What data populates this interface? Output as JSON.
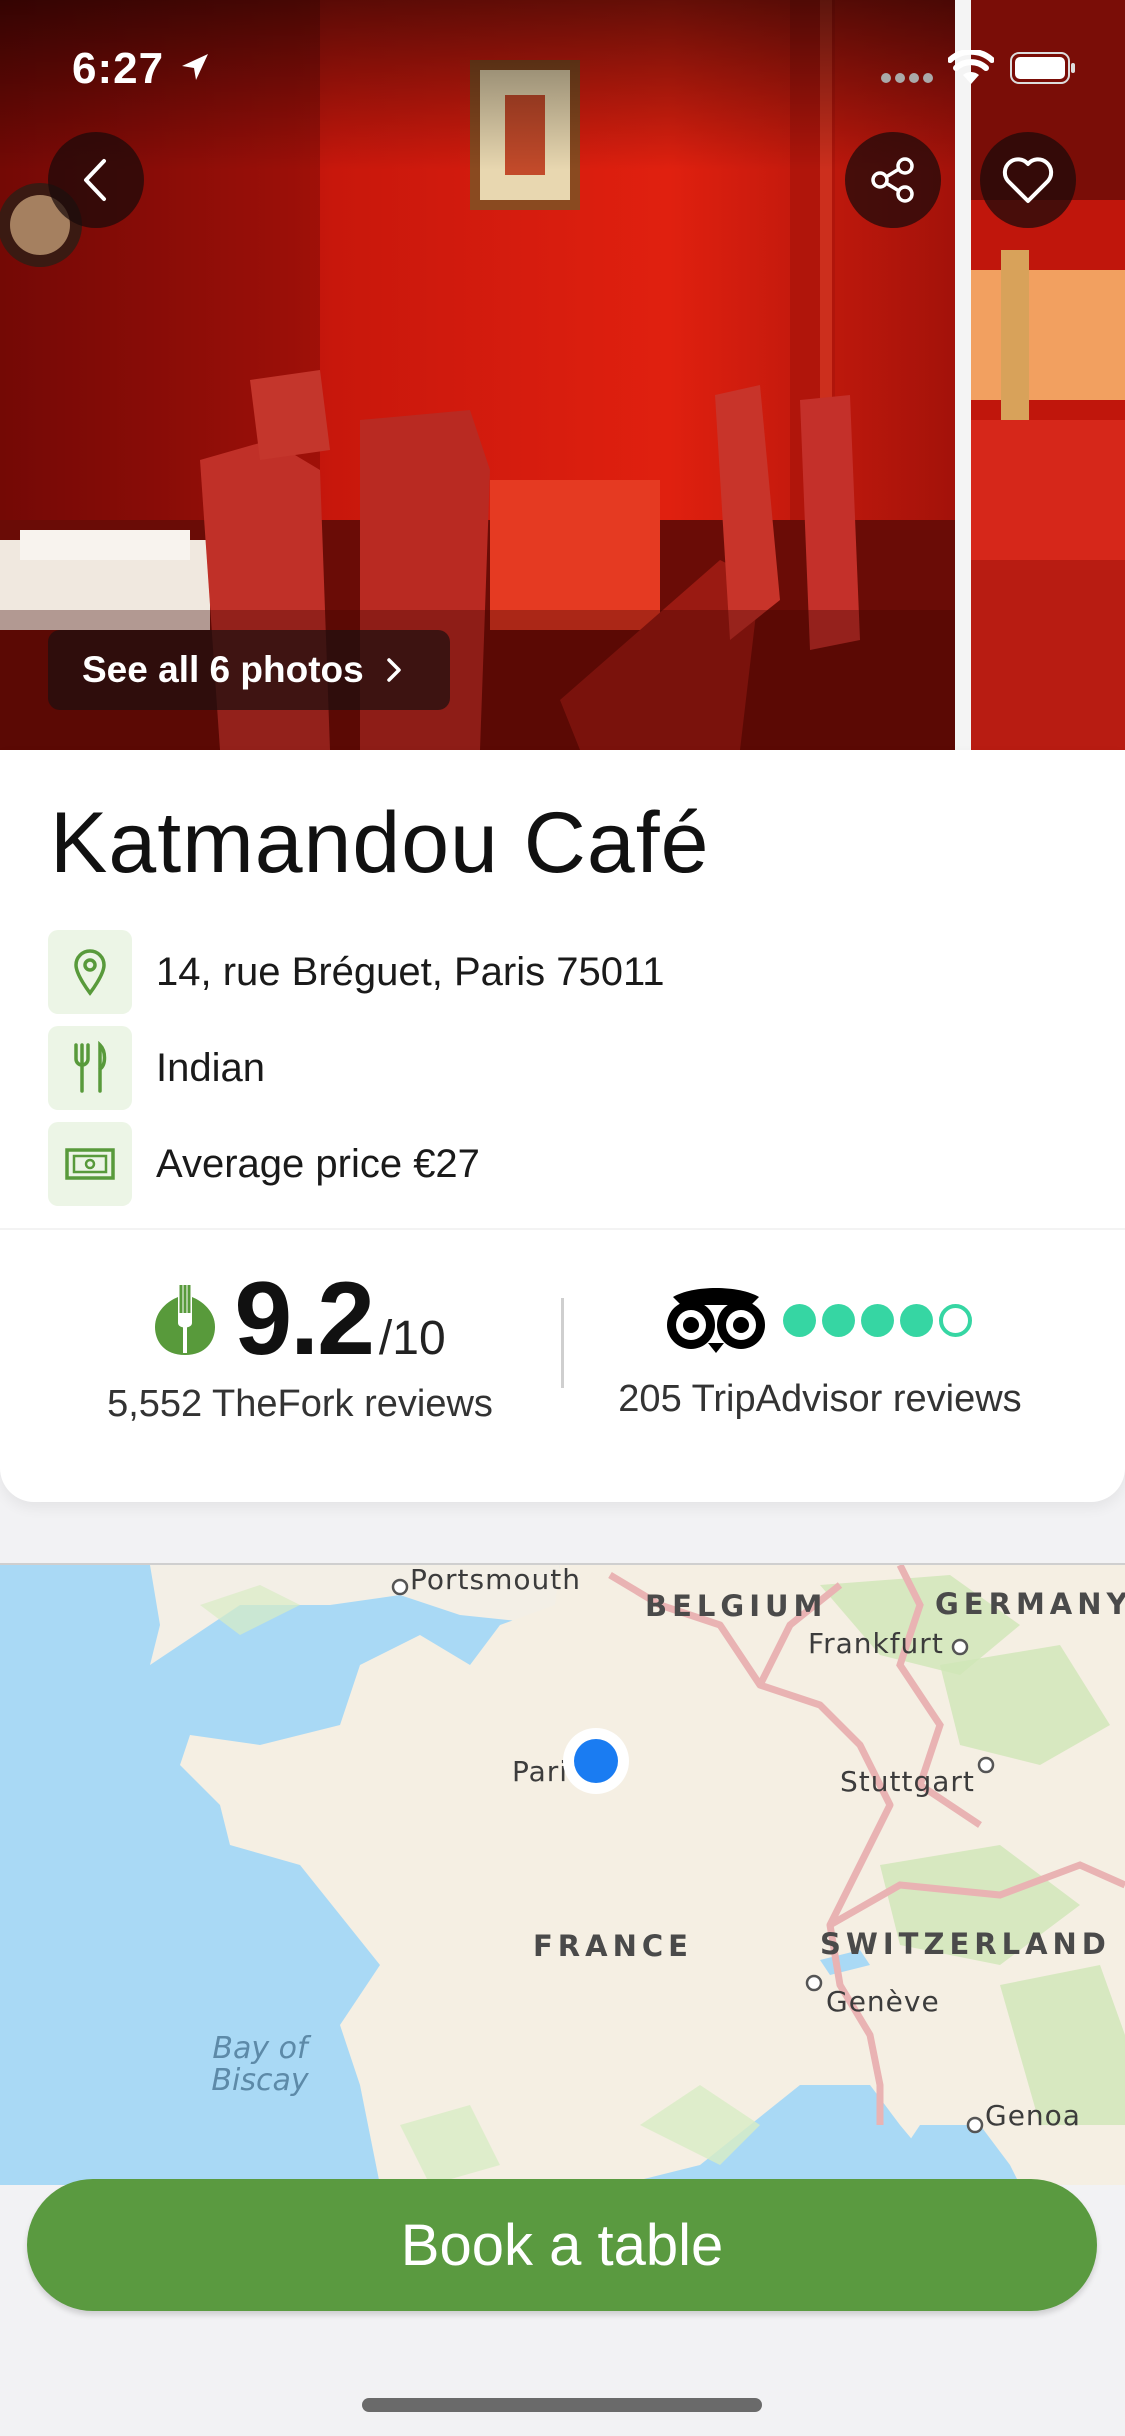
{
  "status_bar": {
    "time": "6:27"
  },
  "hero": {
    "see_photos_label": "See all 6 photos"
  },
  "restaurant": {
    "name": "Katmandou Café",
    "address": "14, rue Bréguet, Paris 75011",
    "cuisine": "Indian",
    "average_price": "Average price €27"
  },
  "ratings": {
    "thefork": {
      "score": "9.2",
      "denominator": "/10",
      "reviews": "5,552 TheFork reviews"
    },
    "tripadvisor": {
      "bubbles": 4,
      "max_bubbles": 5,
      "reviews": "205 TripAdvisor reviews"
    }
  },
  "map": {
    "labels": {
      "portsmouth": "Portsmouth",
      "belgium": "BELGIUM",
      "germany": "GERMANY",
      "frankfurt": "Frankfurt",
      "paris": "Paris",
      "stuttgart": "Stuttgart",
      "france": "FRANCE",
      "switzerland": "SWITZERLAND",
      "geneve": "Genève",
      "bay": "Bay of Biscay",
      "genoa": "Genoa"
    }
  },
  "actions": {
    "book_label": "Book a table"
  },
  "colors": {
    "brand_green": "#5a9a40",
    "icon_green": "#589a3b",
    "tripadvisor_green": "#36d6a3",
    "location_blue": "#1a7cf2"
  },
  "icons": {
    "back": "chevron-left-icon",
    "share": "share-icon",
    "favorite": "heart-icon",
    "location": "map-pin-icon",
    "cuisine": "fork-knife-icon",
    "price": "banknote-icon",
    "thefork_logo": "thefork-logo-icon",
    "tripadvisor_logo": "tripadvisor-owl-icon"
  }
}
